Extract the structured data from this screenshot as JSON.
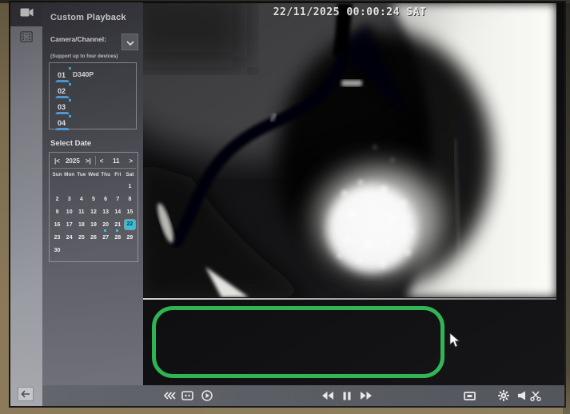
{
  "screen": {
    "osd_timestamp": "22/11/2025 00:00:24 SAT"
  },
  "sidebar": {
    "title": "Custom Playback",
    "camera_channel_label": "Camera/Channel:",
    "support_note": "(Support up to four devices)",
    "channels": [
      {
        "number": "01",
        "name": "D340P",
        "selected": true
      },
      {
        "number": "02",
        "name": "",
        "selected": true
      },
      {
        "number": "03",
        "name": "",
        "selected": true
      },
      {
        "number": "04",
        "name": "",
        "selected": true
      }
    ],
    "select_date_label": "Select Date",
    "calendar": {
      "year": "2025",
      "month": "11",
      "prev_year_label": "|<",
      "next_year_label": ">|",
      "prev_month_label": "<",
      "next_month_label": ">",
      "day_names": [
        "Sun",
        "Mon",
        "Tue",
        "Wed",
        "Thu",
        "Fri",
        "Sat"
      ],
      "weeks": [
        [
          "",
          "",
          "",
          "",
          "",
          "",
          "1"
        ],
        [
          "2",
          "3",
          "4",
          "5",
          "6",
          "7",
          "8"
        ],
        [
          "9",
          "10",
          "11",
          "12",
          "13",
          "14",
          "15"
        ],
        [
          "16",
          "17",
          "18",
          "19",
          "20",
          "21",
          "22"
        ],
        [
          "23",
          "24",
          "25",
          "26",
          "27",
          "28",
          "29"
        ],
        [
          "30",
          "",
          "",
          "",
          "",
          "",
          ""
        ]
      ],
      "selected_day": "22",
      "marked_days": [
        "20",
        "21"
      ]
    }
  },
  "icons": {
    "rail": [
      "video-camera-icon",
      "film-strip-icon",
      "back-arrow-icon"
    ],
    "toolbar": [
      "skip-backward-icon",
      "clip-box-icon",
      "play-circle-icon",
      "rewind-icon",
      "pause-icon",
      "fast-forward-icon",
      "display-icon",
      "gear-icon",
      "speaker-icon",
      "scissors-icon"
    ]
  },
  "colors": {
    "accent_cyan": "#38c3da",
    "channel_blue": "#57a8e8",
    "highlight_green": "#2cb351",
    "toolbar_gray": "#595b63",
    "sidebar_dark": "#3d3d45"
  }
}
